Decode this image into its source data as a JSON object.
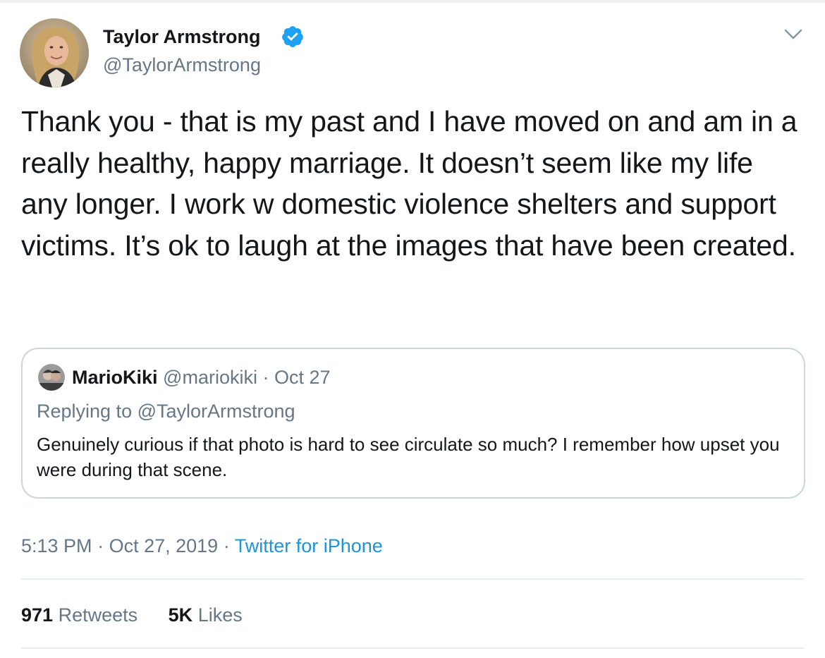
{
  "author": {
    "name": "Taylor Armstrong",
    "handle": "@TaylorArmstrong",
    "verified": true
  },
  "tweet": {
    "text": "Thank you - that is my past and I have moved on and am in a really healthy, happy marriage. It doesn’t seem like my life any longer. I work w domestic violence shelters and support victims. It’s ok to laugh at the images that have been created."
  },
  "quoted_tweet": {
    "name": "MarioKiki",
    "handle": "@mariokiki",
    "date": "Oct 27",
    "replying_to_prefix": "Replying to",
    "replying_to_handle": "@TaylorArmstrong",
    "text": "Genuinely curious if that photo is hard to see circulate so much? I remember how upset you were during that scene."
  },
  "meta": {
    "time": "5:13 PM",
    "date": "Oct 27, 2019",
    "separator": "·",
    "source": "Twitter for iPhone"
  },
  "stats": {
    "retweets_count": "971",
    "retweets_label": "Retweets",
    "likes_count": "5K",
    "likes_label": "Likes"
  },
  "colors": {
    "text_primary": "#14171a",
    "text_secondary": "#657786",
    "link": "#1b95e0",
    "verified_badge": "#1da1f2",
    "border": "#ccd6dd",
    "divider": "#e6ecf0"
  },
  "icons": {
    "verified": "verified-badge-icon",
    "menu": "chevron-down-icon"
  }
}
